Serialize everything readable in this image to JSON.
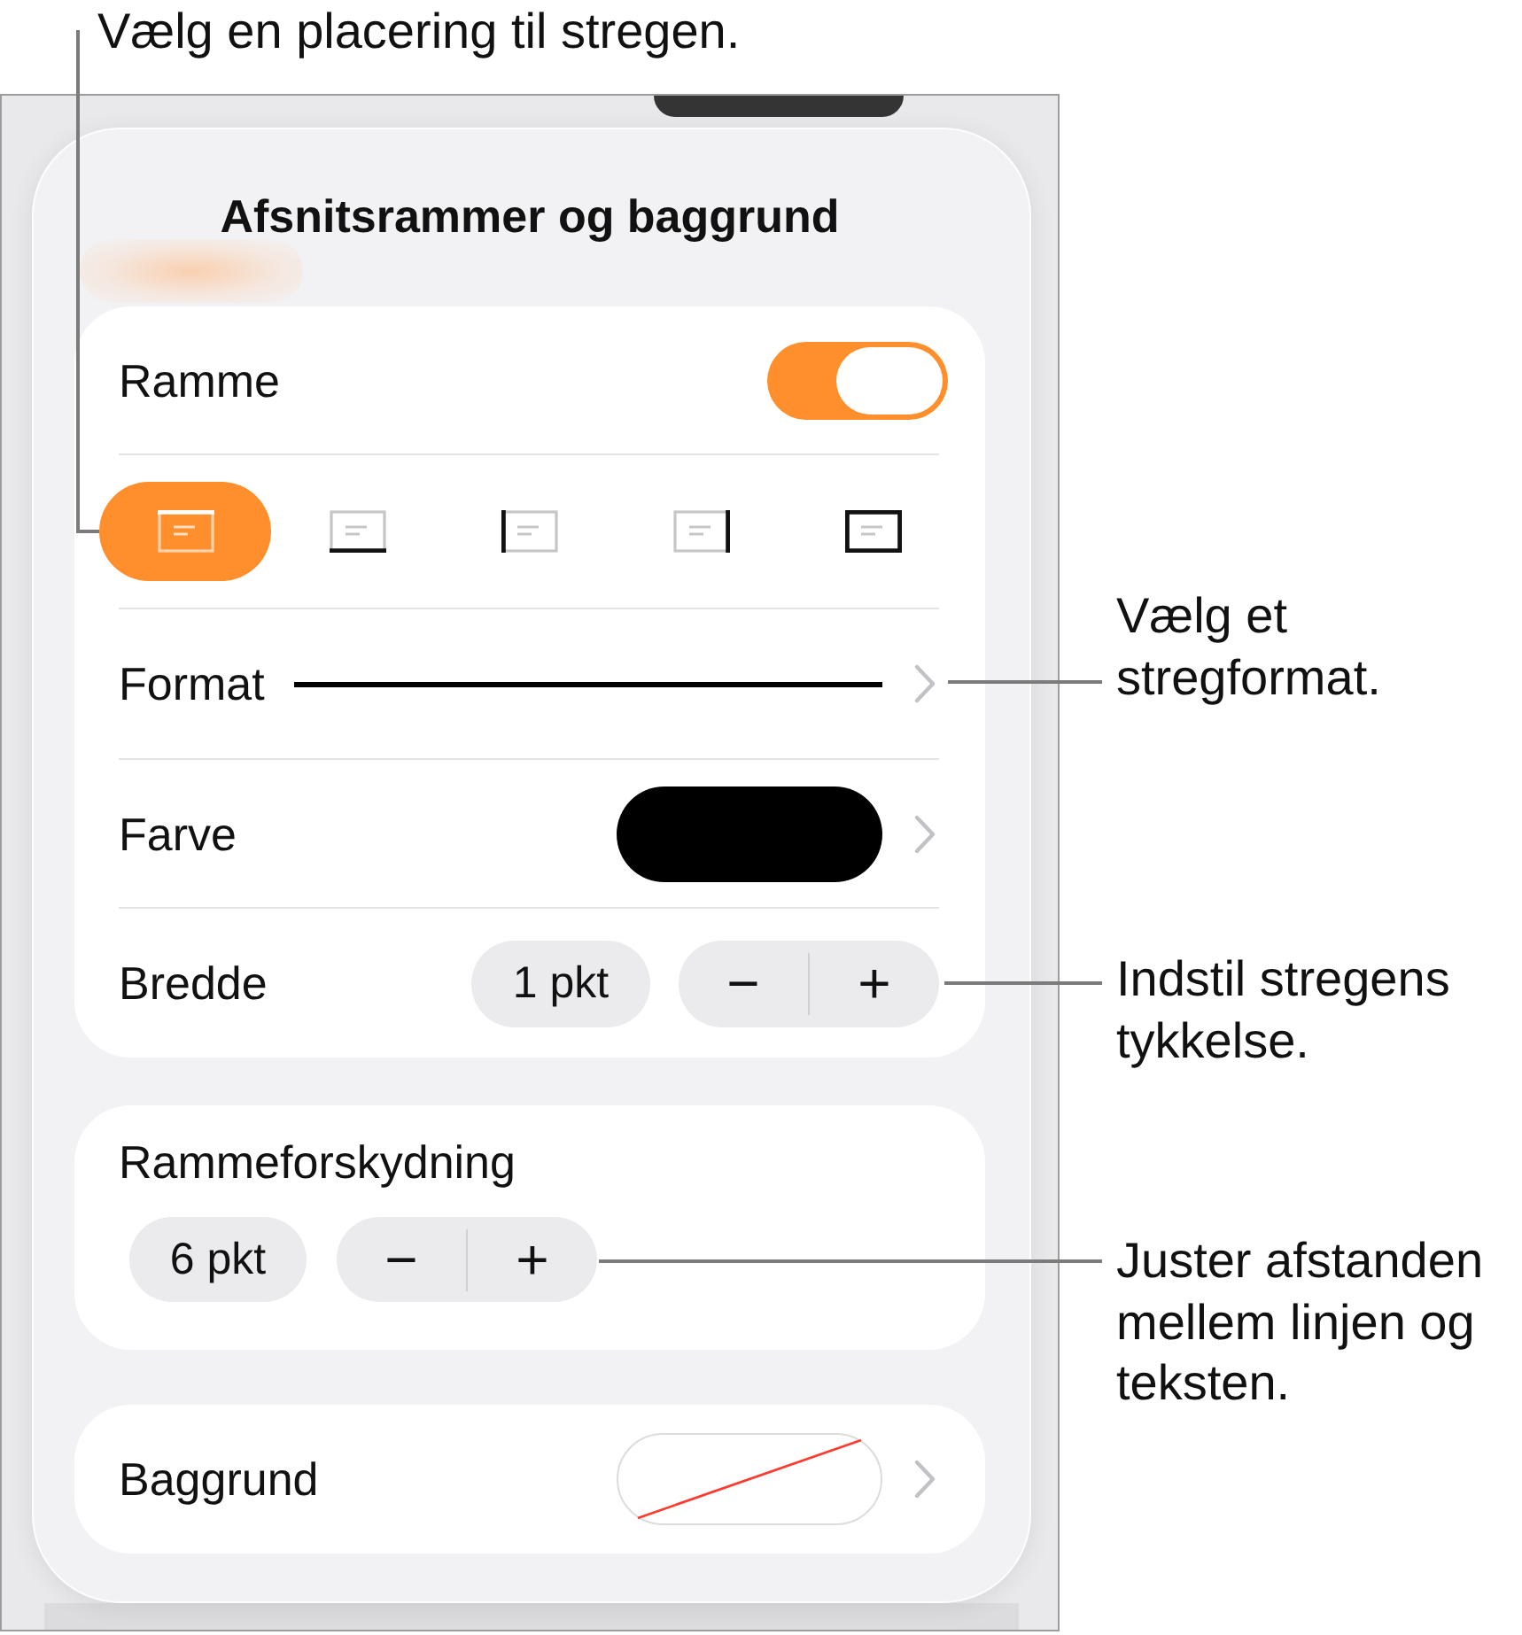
{
  "callouts": [
    {
      "kind": "top",
      "lines": [
        "Vælg en placering til stregen."
      ]
    },
    {
      "kind": "format",
      "lines": [
        "Vælg et",
        "stregformat."
      ]
    },
    {
      "kind": "width",
      "lines": [
        "Indstil stregens",
        "tykkelse."
      ]
    },
    {
      "kind": "offset",
      "lines": [
        "Juster afstanden",
        "mellem linjen og",
        "teksten."
      ]
    }
  ],
  "popover": {
    "title": "Afsnitsrammer og baggrund",
    "border": {
      "label": "Ramme",
      "on": true,
      "positions": [
        {
          "kind": "top",
          "selected": true
        },
        {
          "kind": "bottom",
          "selected": false
        },
        {
          "kind": "left",
          "selected": false
        },
        {
          "kind": "right",
          "selected": false
        },
        {
          "kind": "all",
          "selected": false
        }
      ],
      "format": {
        "label": "Format"
      },
      "color": {
        "label": "Farve",
        "color": "#000000"
      },
      "width": {
        "label": "Bredde",
        "value": "1 pkt",
        "minus": "−",
        "plus": "+"
      }
    },
    "offset": {
      "label": "Rammeforskydning",
      "value": "6 pkt",
      "minus": "−",
      "plus": "+"
    },
    "background": {
      "label": "Baggrund"
    }
  }
}
